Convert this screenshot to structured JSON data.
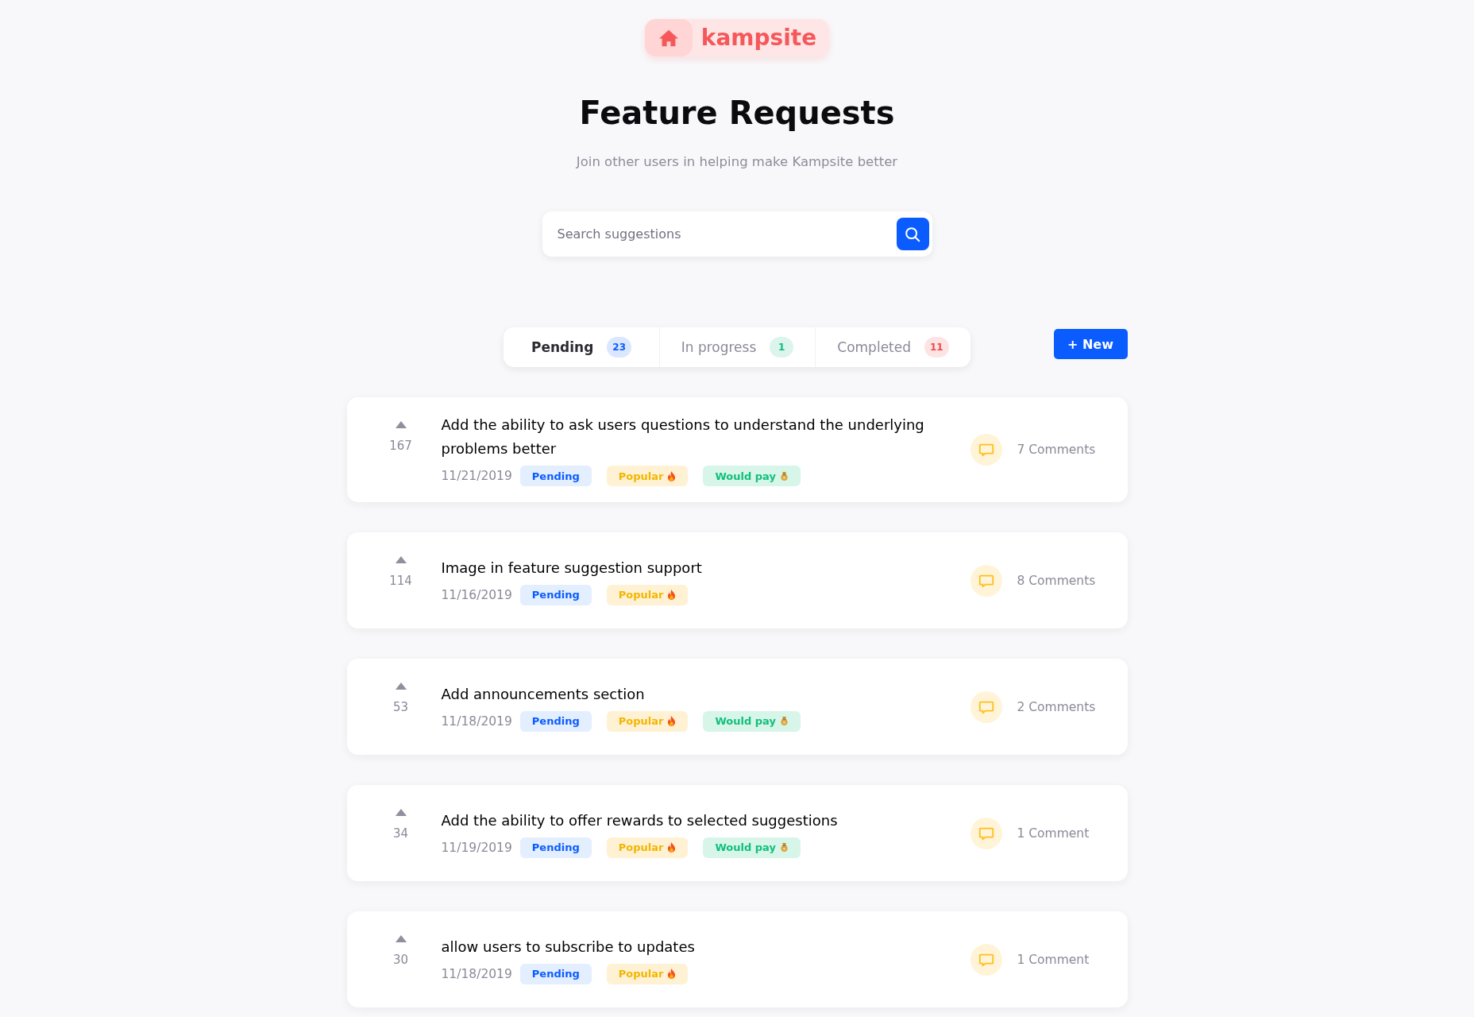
{
  "logo": {
    "text": "kampsite"
  },
  "header": {
    "title": "Feature Requests",
    "subtitle": "Join other users in helping make Kampsite better"
  },
  "search": {
    "placeholder": "Search suggestions"
  },
  "tabs": [
    {
      "label": "Pending",
      "count": "23",
      "color": "#0a5cff",
      "selected": true
    },
    {
      "label": "In progress",
      "count": "1",
      "color": "#10b981",
      "selected": false
    },
    {
      "label": "Completed",
      "count": "11",
      "color": "#f04848",
      "selected": false
    }
  ],
  "new_button": {
    "label": "+ New"
  },
  "requests": [
    {
      "votes": "167",
      "title": "Add the ability to ask users questions to understand the underlying problems better",
      "date": "11/21/2019",
      "tags": [
        {
          "kind": "status",
          "label": "Pending"
        },
        {
          "kind": "popular",
          "label": "Popular"
        },
        {
          "kind": "paying",
          "label": "Would pay"
        }
      ],
      "comments": "7 Comments"
    },
    {
      "votes": "114",
      "title": "Image in feature suggestion support",
      "date": "11/16/2019",
      "tags": [
        {
          "kind": "status",
          "label": "Pending"
        },
        {
          "kind": "popular",
          "label": "Popular"
        }
      ],
      "comments": "8 Comments"
    },
    {
      "votes": "53",
      "title": "Add announcements section",
      "date": "11/18/2019",
      "tags": [
        {
          "kind": "status",
          "label": "Pending"
        },
        {
          "kind": "popular",
          "label": "Popular"
        },
        {
          "kind": "paying",
          "label": "Would pay"
        }
      ],
      "comments": "2 Comments"
    },
    {
      "votes": "34",
      "title": "Add the ability to offer rewards to selected suggestions",
      "date": "11/19/2019",
      "tags": [
        {
          "kind": "status",
          "label": "Pending"
        },
        {
          "kind": "popular",
          "label": "Popular"
        },
        {
          "kind": "paying",
          "label": "Would pay"
        }
      ],
      "comments": "1 Comment"
    },
    {
      "votes": "30",
      "title": "allow users to subscribe to updates",
      "date": "11/18/2019",
      "tags": [
        {
          "kind": "status",
          "label": "Pending"
        },
        {
          "kind": "popular",
          "label": "Popular"
        }
      ],
      "comments": "1 Comment"
    }
  ]
}
